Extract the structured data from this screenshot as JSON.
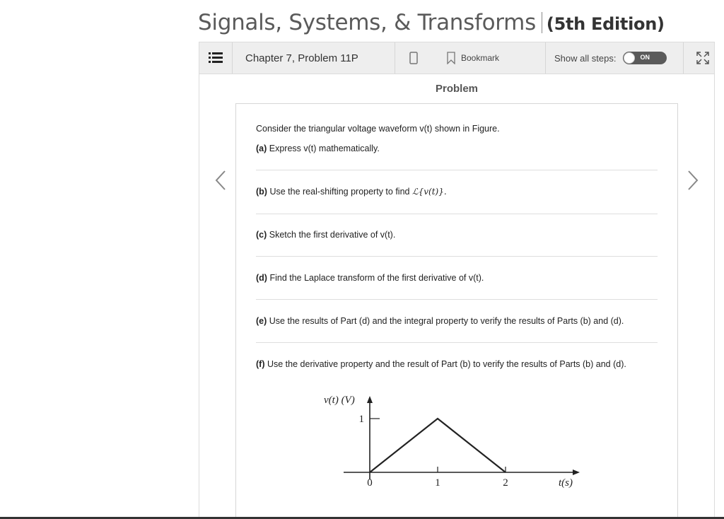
{
  "book": {
    "title": "Signals, Systems, & Transforms",
    "edition": "(5th Edition)"
  },
  "toolbar": {
    "chapter_label": "Chapter 7, Problem 11P",
    "bookmark_label": "Bookmark",
    "show_steps_label": "Show all steps:",
    "toggle_label": "ON"
  },
  "problem": {
    "heading": "Problem",
    "intro": "Consider the triangular voltage waveform v(t) shown in Figure.",
    "parts": {
      "a": {
        "tag": "(a)",
        "text": "Express v(t) mathematically."
      },
      "b": {
        "tag": "(b)",
        "text": "Use the real-shifting property to find",
        "math": "ℒ{v(t)}."
      },
      "c": {
        "tag": "(c)",
        "text": "Sketch the first derivative of v(t)."
      },
      "d": {
        "tag": "(d)",
        "text": "Find the Laplace transform of the first derivative of v(t)."
      },
      "e": {
        "tag": "(e)",
        "text": "Use the results of Part (d) and the integral property to verify the results of Parts (b) and (d)."
      },
      "f": {
        "tag": "(f)",
        "text": "Use the derivative property and the result of Part (b) to verify the results of Parts (b) and (d)."
      }
    }
  },
  "figure": {
    "y_axis_label": "v(t) (V)",
    "x_axis_label": "t(s)",
    "y_tick": "1",
    "x_ticks": [
      "0",
      "1",
      "2"
    ]
  },
  "chart_data": {
    "type": "line",
    "x": [
      0,
      1,
      2
    ],
    "y": [
      0,
      1,
      0
    ],
    "xlabel": "t(s)",
    "ylabel": "v(t) (V)"
  },
  "icons": {
    "menu": "list-icon",
    "phone": "mobile-icon",
    "bookmark": "bookmark-icon",
    "expand": "expand-icon",
    "prev": "chevron-left-icon",
    "next": "chevron-right-icon"
  }
}
